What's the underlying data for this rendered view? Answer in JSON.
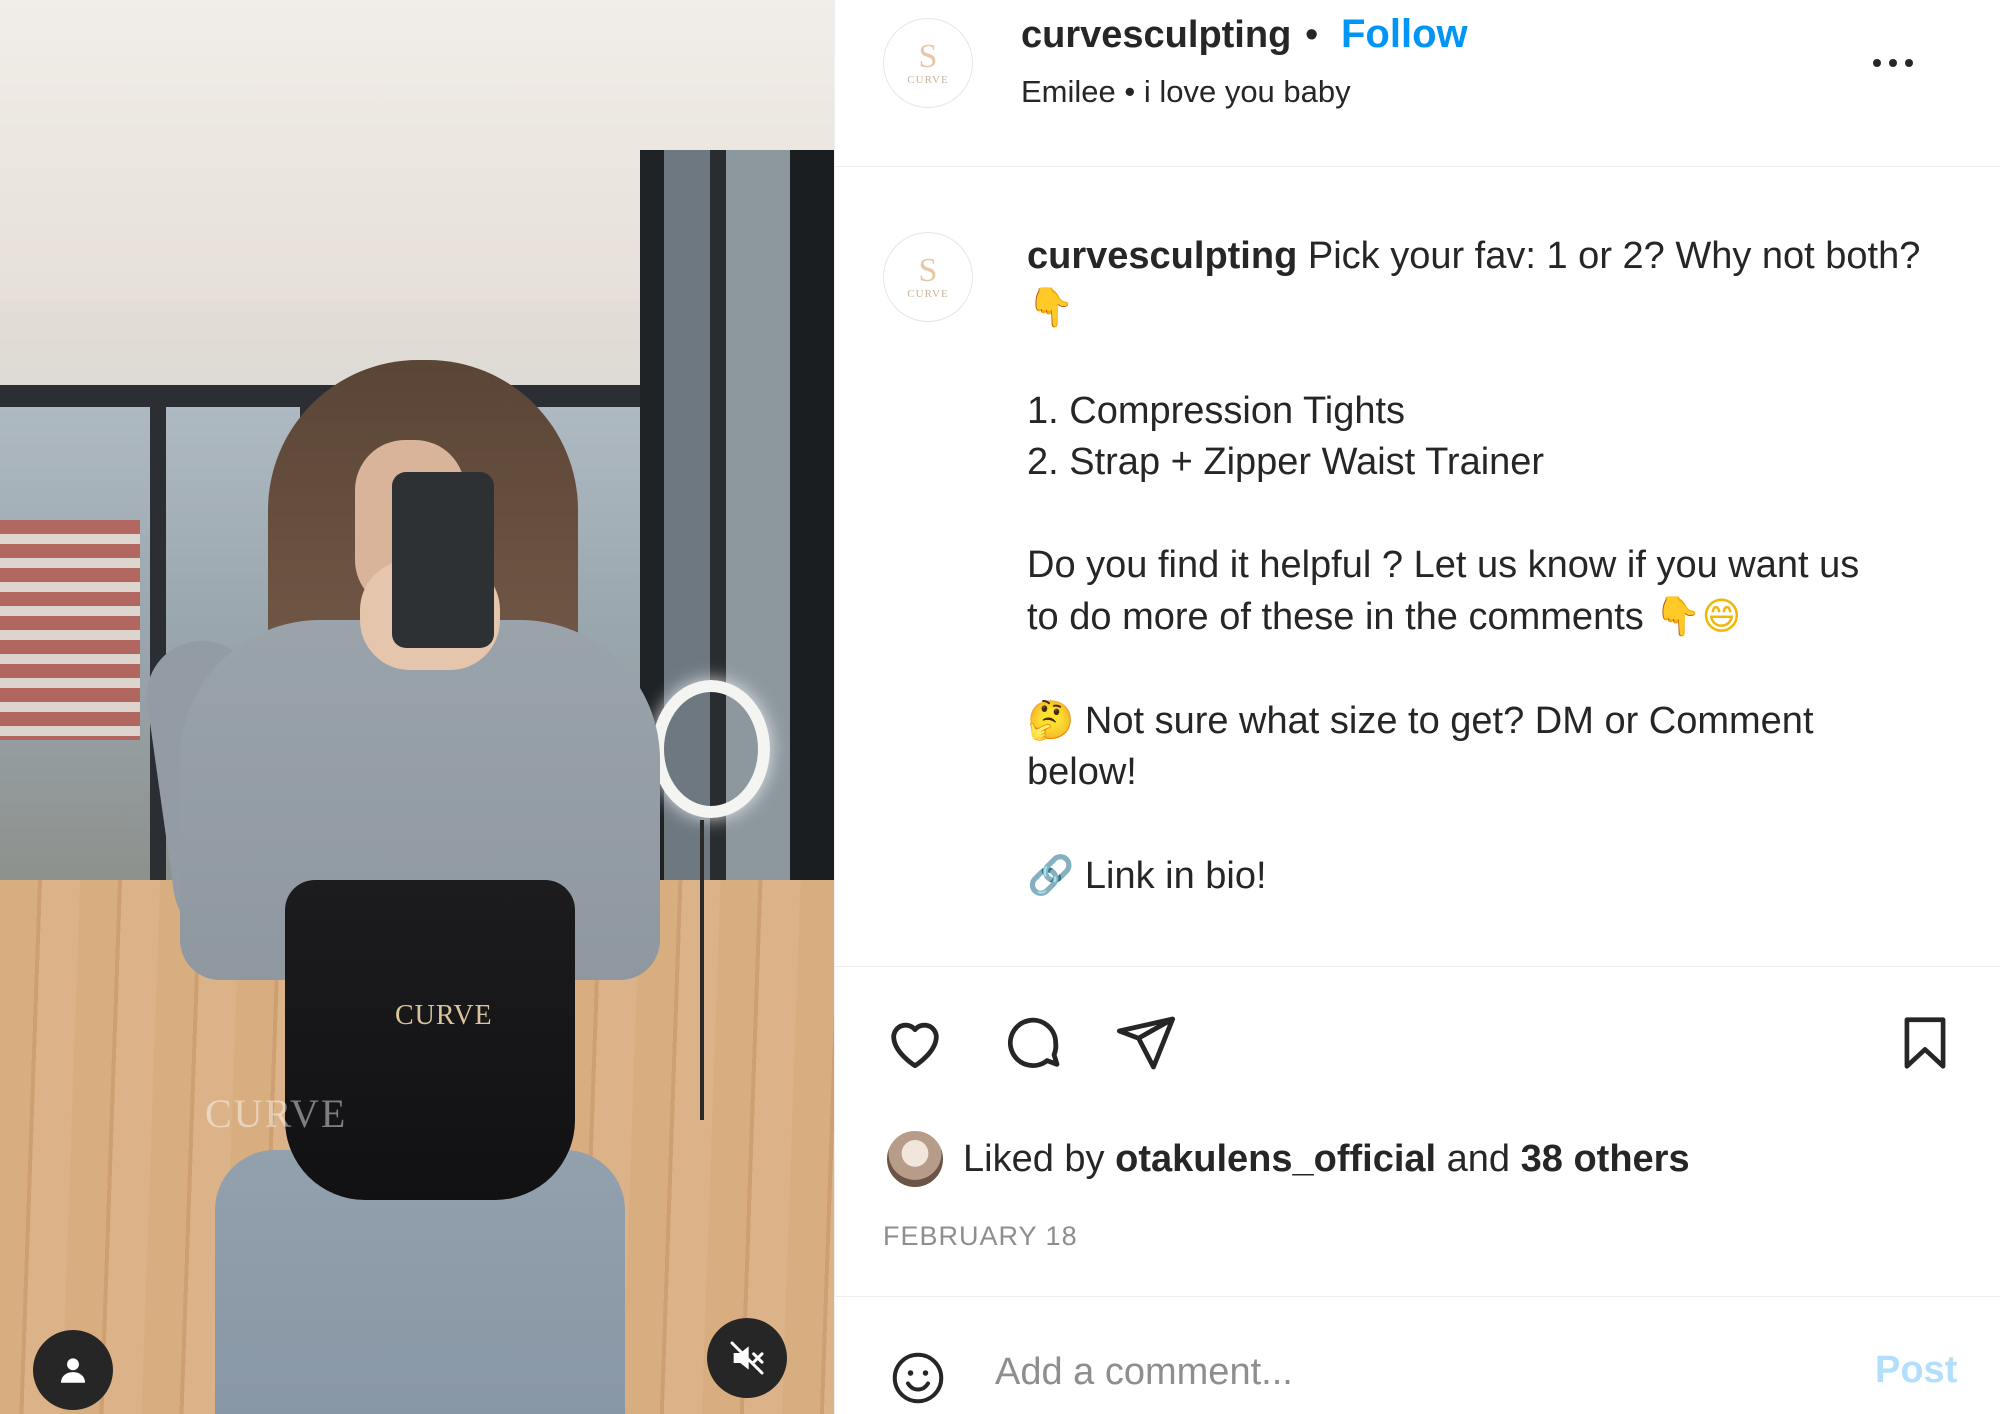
{
  "post": {
    "author": "curvesculpting",
    "follow_label": "Follow",
    "separator": "•",
    "subtitle": "Emilee • i love you baby",
    "avatar_logo_glyph": "S",
    "avatar_logo_text": "CURVE"
  },
  "media": {
    "brand_mark": "CURVE",
    "watermark": "CURVE",
    "user_tag_icon": "user-icon",
    "mute_icon": "speaker-muted-icon"
  },
  "caption": {
    "author": "curvesculpting",
    "lines": [
      "Pick your fav: 1 or 2? Why not both?",
      "1. Compression Tights",
      "2. Strap + Zipper Waist Trainer",
      "Do you find it helpful ? Let us know if you want us",
      "to do more of these in the comments",
      "Not sure what size to get? DM or Comment",
      "below!",
      "Link in bio!"
    ],
    "emojis": {
      "pointing_down": "👇",
      "grin": "😄",
      "thinking": "🤔",
      "link": "🔗"
    }
  },
  "actions": {
    "like_icon": "heart-icon",
    "comment_icon": "comment-icon",
    "share_icon": "paper-plane-icon",
    "save_icon": "bookmark-icon"
  },
  "likes": {
    "prefix": "Liked by",
    "user": "otakulens_official",
    "joiner": "and",
    "others": "38 others"
  },
  "date": "FEBRUARY 18",
  "composer": {
    "placeholder": "Add a comment...",
    "post_label": "Post"
  },
  "colors": {
    "accent": "#0095f6",
    "post_disabled": "#b2dffc",
    "muted_text": "#8e8e8e",
    "divider": "#efefef"
  }
}
